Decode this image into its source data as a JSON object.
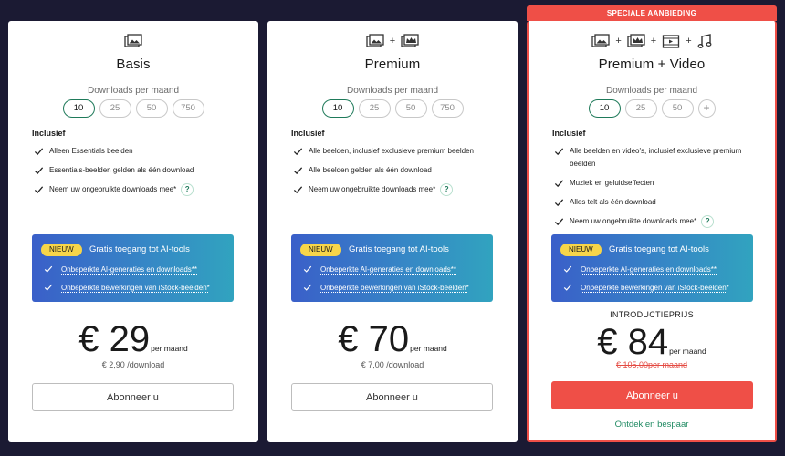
{
  "ribbon": "SPECIALE AANBIEDING",
  "common": {
    "downloads_label": "Downloads per maand",
    "inclusief": "Inclusief",
    "nieuw": "NIEUW",
    "ai_title": "Gratis toegang tot AI-tools",
    "ai_item_1": "Onbeperkte AI-generaties en downloads**",
    "ai_item_2": "Onbeperkte bewerkingen van iStock-beelden*",
    "per_maand": "per maand",
    "subscribe": "Abonneer u",
    "help": "?"
  },
  "plans": [
    {
      "title": "Basis",
      "icons": [
        "images-icon"
      ],
      "options": [
        "10",
        "25",
        "50",
        "750"
      ],
      "selected": "10",
      "features": [
        "Alleen Essentials beelden",
        "Essentials-beelden gelden als één download",
        "Neem uw ongebruikte downloads mee*"
      ],
      "price": "€ 29",
      "per_download": "€ 2,90 /download"
    },
    {
      "title": "Premium",
      "icons": [
        "images-icon",
        "premium-images-icon"
      ],
      "options": [
        "10",
        "25",
        "50",
        "750"
      ],
      "selected": "10",
      "features": [
        "Alle beelden, inclusief exclusieve premium beelden",
        "Alle beelden gelden als één download",
        "Neem uw ongebruikte downloads mee*"
      ],
      "price": "€ 70",
      "per_download": "€ 7,00 /download"
    },
    {
      "title": "Premium + Video",
      "icons": [
        "images-icon",
        "premium-images-icon",
        "video-icon",
        "music-icon"
      ],
      "options": [
        "10",
        "25",
        "50",
        "+"
      ],
      "selected": "10",
      "features": [
        "Alle beelden en video's, inclusief exclusieve premium beelden",
        "Muziek en geluidseffecten",
        "Alles telt als één download",
        "Neem uw ongebruikte downloads mee*"
      ],
      "intro_label": "INTRODUCTIEPRIJS",
      "price": "€ 84",
      "old_price": "€ 105,00per maand",
      "link": "Ontdek en bespaar"
    }
  ],
  "colors": {
    "accent_red": "#ef4f47",
    "accent_green": "#1f7a5a",
    "nieuw_yellow": "#f7d549",
    "background": "#1b1a33"
  }
}
